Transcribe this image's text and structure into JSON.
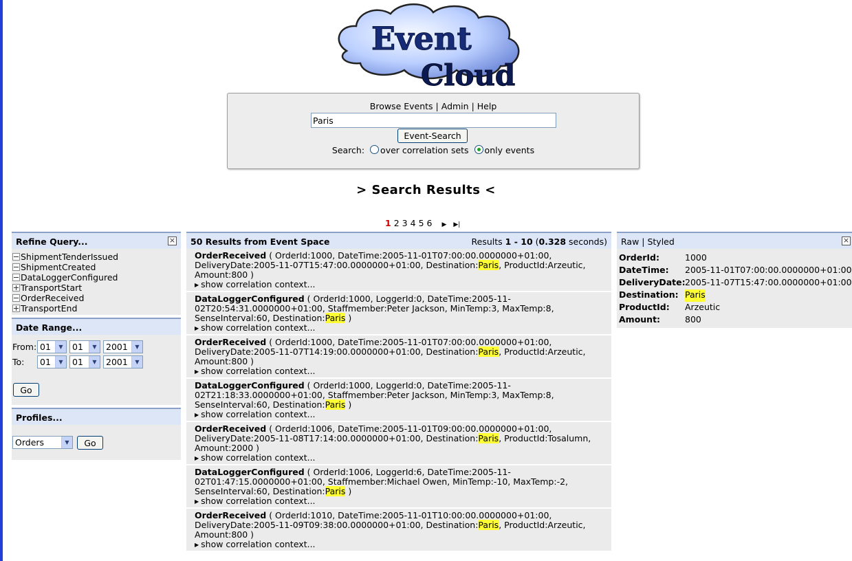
{
  "logo": {
    "line1": "Event",
    "line2": "Cloud"
  },
  "nav": {
    "browse": "Browse Events",
    "admin": "Admin",
    "help": "Help"
  },
  "search": {
    "value": "Paris",
    "button": "Event-Search",
    "label": "Search:",
    "option1": "over correlation sets",
    "option2": "only events",
    "selected": "only events"
  },
  "results_title": "> Search Results <",
  "pager": {
    "pages": [
      "1",
      "2",
      "3",
      "4",
      "5",
      "6"
    ],
    "current": "1"
  },
  "refine": {
    "title": "Refine Query...",
    "items": [
      {
        "label": "ShipmentTenderIssued",
        "state": "minus"
      },
      {
        "label": "ShipmentCreated",
        "state": "minus"
      },
      {
        "label": "DataLoggerConfigured",
        "state": "minus"
      },
      {
        "label": "TransportStart",
        "state": "plus"
      },
      {
        "label": "OrderReceived",
        "state": "minus"
      },
      {
        "label": "TransportEnd",
        "state": "plus"
      }
    ]
  },
  "daterange": {
    "title": "Date Range...",
    "from_label": "From:",
    "to_label": "To:",
    "from": {
      "day": "01",
      "month": "01",
      "year": "2001"
    },
    "to": {
      "day": "01",
      "month": "01",
      "year": "2001"
    },
    "go": "Go"
  },
  "profiles": {
    "title": "Profiles...",
    "selected": "Orders",
    "go": "Go"
  },
  "results": {
    "header": "50 Results from Event Space",
    "summary_prefix": "Results ",
    "range": "1 - 10",
    "time": "0.328",
    "seconds": " seconds)",
    "context_label": "show correlation context...",
    "items": [
      {
        "event": "OrderReceived",
        "pre": " ( OrderId:1000, DateTime:2005-11-01T07:00:00.0000000+01:00, DeliveryDate:2005-11-07T15:47:00.0000000+01:00, Destination:",
        "hl": "Paris",
        "post": ", ProductId:Arzeutic, Amount:800 )"
      },
      {
        "event": "DataLoggerConfigured",
        "pre": " ( OrderId:1000, LoggerId:0, DateTime:2005-11-02T20:54:31.0000000+01:00, Staffmember:Peter Jackson, MinTemp:3, MaxTemp:8, SenseInterval:60, Destination:",
        "hl": "Paris",
        "post": " )"
      },
      {
        "event": "OrderReceived",
        "pre": " ( OrderId:1000, DateTime:2005-11-01T07:00:00.0000000+01:00, DeliveryDate:2005-11-07T14:19:00.0000000+01:00, Destination:",
        "hl": "Paris",
        "post": ", ProductId:Arzeutic, Amount:800 )"
      },
      {
        "event": "DataLoggerConfigured",
        "pre": " ( OrderId:1000, LoggerId:0, DateTime:2005-11-02T21:18:33.0000000+01:00, Staffmember:Peter Jackson, MinTemp:3, MaxTemp:8, SenseInterval:60, Destination:",
        "hl": "Paris",
        "post": " )"
      },
      {
        "event": "OrderReceived",
        "pre": " ( OrderId:1006, DateTime:2005-11-01T09:00:00.0000000+01:00, DeliveryDate:2005-11-08T17:14:00.0000000+01:00, Destination:",
        "hl": "Paris",
        "post": ", ProductId:Tosalumn, Amount:2000 )"
      },
      {
        "event": "DataLoggerConfigured",
        "pre": " ( OrderId:1006, LoggerId:6, DateTime:2005-11-02T01:47:15.0000000+01:00, Staffmember:Michael Owen, MinTemp:-10, MaxTemp:-2, SenseInterval:60, Destination:",
        "hl": "Paris",
        "post": " )"
      },
      {
        "event": "OrderReceived",
        "pre": " ( OrderId:1010, DateTime:2005-11-01T10:00:00.0000000+01:00, DeliveryDate:2005-11-09T09:38:00.0000000+01:00, Destination:",
        "hl": "Paris",
        "post": ", ProductId:Arzeutic, Amount:800 )"
      }
    ]
  },
  "raw": {
    "tab_raw": "Raw",
    "tab_styled": "Styled",
    "fields": [
      {
        "key": "OrderId:",
        "value": "1000"
      },
      {
        "key": "DateTime:",
        "value": "2005-11-01T07:00:00.0000000+01:00"
      },
      {
        "key": "DeliveryDate:",
        "value": "2005-11-07T15:47:00.0000000+01:00"
      },
      {
        "key": "Destination:",
        "value": "Paris",
        "highlight": true
      },
      {
        "key": "ProductId:",
        "value": "Arzeutic"
      },
      {
        "key": "Amount:",
        "value": "800"
      }
    ]
  },
  "colors": {
    "panel_header": "#dde6f7",
    "panel_body": "#ebebeb",
    "highlight": "#ffff33",
    "current_page": "#d00000"
  }
}
